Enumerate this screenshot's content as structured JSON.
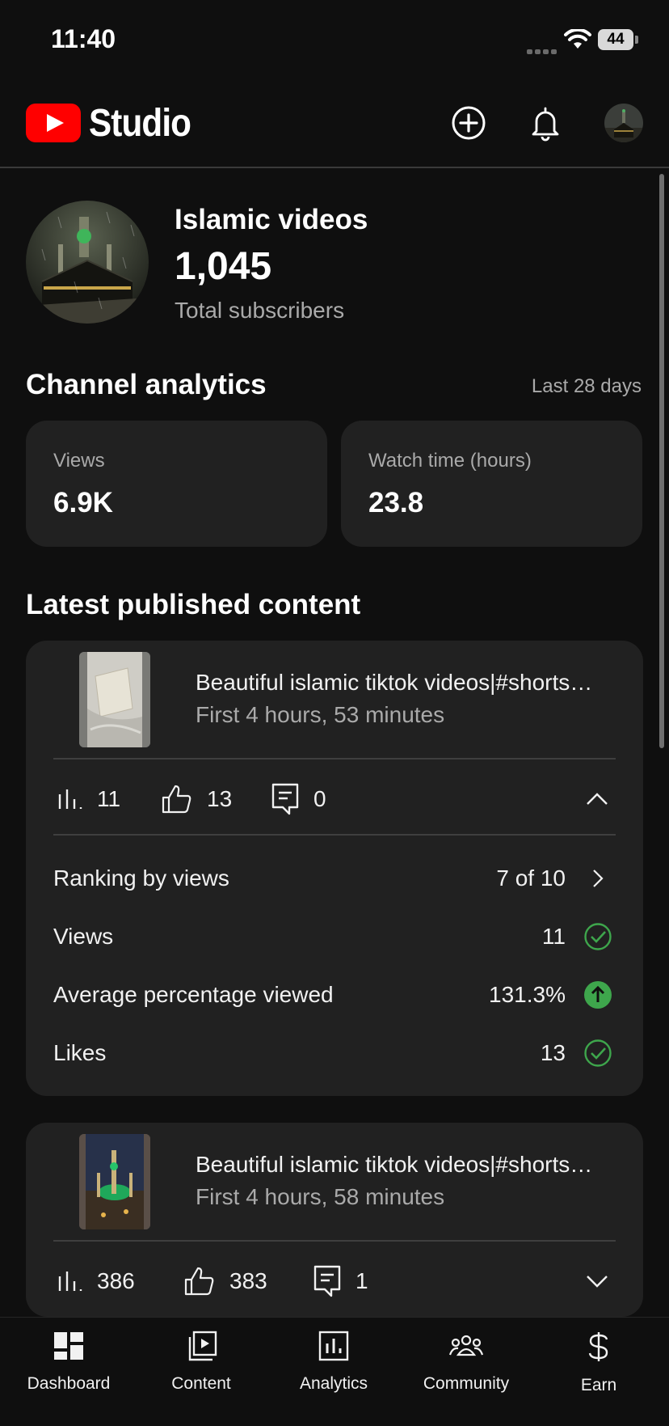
{
  "status_bar": {
    "time": "11:40",
    "battery": "44"
  },
  "app": {
    "logo_text": "Studio"
  },
  "channel": {
    "name": "Islamic videos",
    "subscriber_count": "1,045",
    "subscriber_label": "Total subscribers"
  },
  "analytics": {
    "title": "Channel analytics",
    "range": "Last 28 days",
    "cards": [
      {
        "label": "Views",
        "value": "6.9K"
      },
      {
        "label": "Watch time (hours)",
        "value": "23.8"
      }
    ]
  },
  "latest": {
    "title": "Latest published content",
    "items": [
      {
        "title": "Beautiful islamic tiktok videos|#shorts…",
        "subtitle": "First 4 hours, 53 minutes",
        "views": "11",
        "likes": "13",
        "comments": "0",
        "expanded": true,
        "details": [
          {
            "label": "Ranking by views",
            "value": "7 of 10",
            "icon": "chevron-right-icon"
          },
          {
            "label": "Views",
            "value": "11",
            "icon": "check-circle-icon"
          },
          {
            "label": "Average percentage viewed",
            "value": "131.3%",
            "icon": "arrow-up-circle-icon"
          },
          {
            "label": "Likes",
            "value": "13",
            "icon": "check-circle-icon"
          }
        ]
      },
      {
        "title": "Beautiful islamic tiktok videos|#shorts…",
        "subtitle": "First 4 hours, 58 minutes",
        "views": "386",
        "likes": "383",
        "comments": "1",
        "expanded": false
      }
    ]
  },
  "bottom_nav": [
    {
      "label": "Dashboard",
      "icon": "dashboard-icon"
    },
    {
      "label": "Content",
      "icon": "content-icon"
    },
    {
      "label": "Analytics",
      "icon": "analytics-icon"
    },
    {
      "label": "Community",
      "icon": "community-icon"
    },
    {
      "label": "Earn",
      "icon": "dollar-icon"
    }
  ],
  "colors": {
    "accent_green": "#3ea64c",
    "brand_red": "#ff0000",
    "card_bg": "#212121"
  }
}
